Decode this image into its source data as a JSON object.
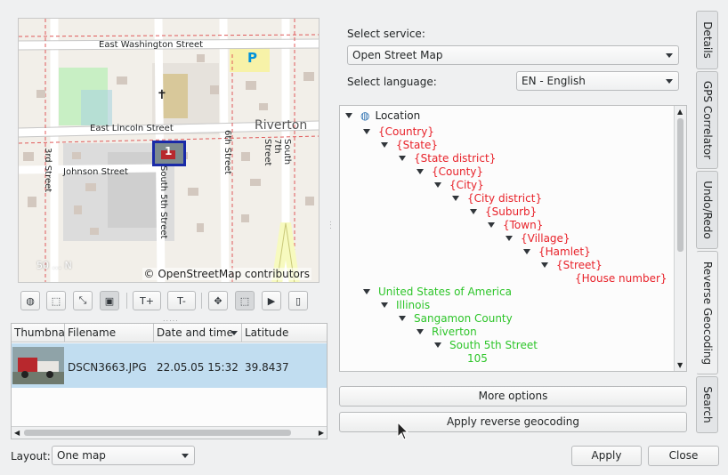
{
  "map": {
    "labels": {
      "street_top": "East Washington Street",
      "street_lincoln": "East Lincoln Street",
      "city": "Riverton",
      "street_3rd": "3rd Street",
      "street_johnson": "Johnson Street",
      "street_south5": "South 5th Street",
      "street_6th": "6th Street",
      "street_south7": "South 7th Street",
      "parking": "P",
      "marker_count": "1"
    },
    "attribution": "© OpenStreetMap contributors",
    "scale": "50 ... N"
  },
  "toolbar": {
    "buttons": [
      {
        "name": "globe-icon",
        "glyph": "◍"
      },
      {
        "name": "zoom-region-icon",
        "glyph": "⬚"
      },
      {
        "name": "zoom-fit-icon",
        "glyph": "⤡"
      },
      {
        "name": "thumbnails-icon",
        "glyph": "▣"
      },
      {
        "name": "thumbnail-larger-button",
        "glyph": "T+"
      },
      {
        "name": "thumbnail-smaller-button",
        "glyph": "T-"
      },
      {
        "name": "pan-icon",
        "glyph": "✥"
      },
      {
        "name": "select-region-icon",
        "glyph": "⬚"
      },
      {
        "name": "pointer-icon",
        "glyph": "▶"
      },
      {
        "name": "bookmark-icon",
        "glyph": "▯"
      }
    ]
  },
  "table": {
    "headers": [
      "Thumbna",
      "Filename",
      "Date and time",
      "Latitude"
    ],
    "rows": [
      {
        "filename": "DSCN3663.JPG",
        "datetime": "22.05.05 15:32",
        "latitude": "39.8437"
      }
    ]
  },
  "layout": {
    "label": "Layout:",
    "value": "One map"
  },
  "service": {
    "label": "Select service:",
    "value": "Open Street Map"
  },
  "language": {
    "label": "Select language:",
    "value": "EN - English"
  },
  "tree": {
    "root": "Location",
    "template": [
      "{Country}",
      "{State}",
      "{State district}",
      "{County}",
      "{City}",
      "{City district}",
      "{Suburb}",
      "{Town}",
      "{Village}",
      "{Hamlet}",
      "{Street}",
      "{House number}"
    ],
    "result": [
      "United States of America",
      "Illinois",
      "Sangamon County",
      "Riverton",
      "South 5th Street",
      "105"
    ]
  },
  "buttons": {
    "more_options": "More options",
    "apply_geocoding": "Apply reverse geocoding",
    "apply": "Apply",
    "close": "Close"
  },
  "tabs": [
    "Details",
    "GPS Correlator",
    "Undo/Redo",
    "Reverse Geocoding",
    "Search"
  ],
  "colors": {
    "template_tags": "#e8222a",
    "result_values": "#2ec52a",
    "selection": "#c1ddf0"
  }
}
